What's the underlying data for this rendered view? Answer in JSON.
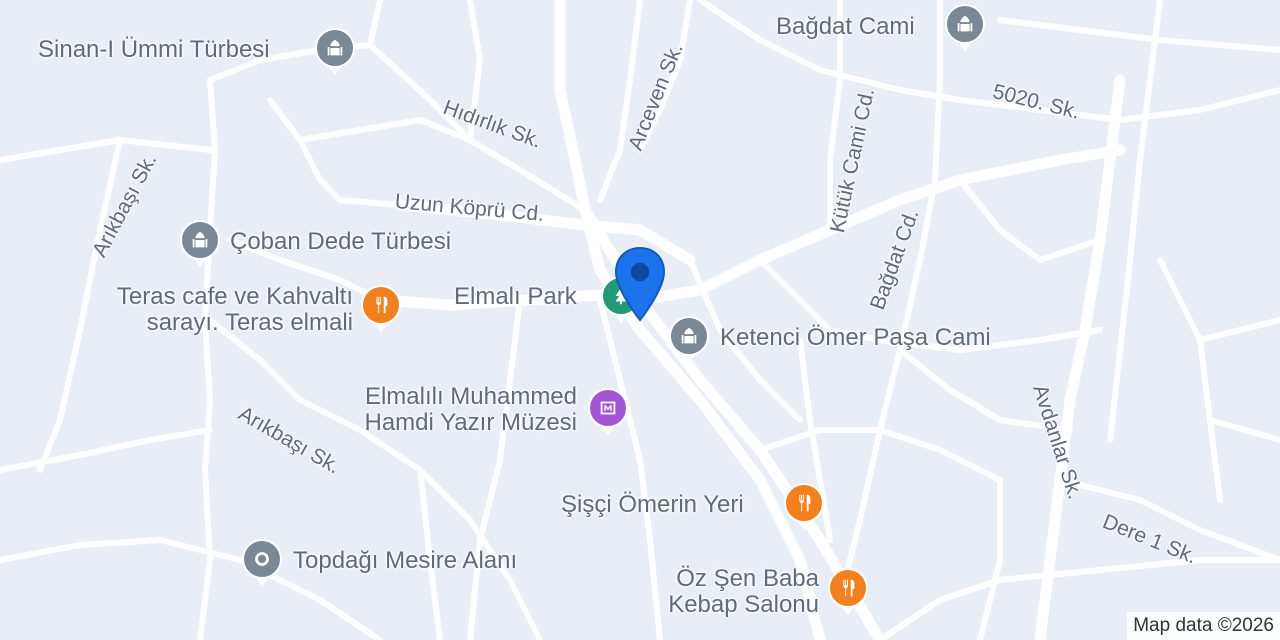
{
  "colors": {
    "land": "#e9edf6",
    "road": "#ffffff",
    "place_pin": "#7a8794",
    "food_pin": "#f2801e",
    "park_pin": "#1f9b76",
    "museum_pin": "#a256d6",
    "location_pin": "#1a73e8"
  },
  "places": {
    "sinan_turbesi": "Sinan-I Ümmi Türbesi",
    "bagdat_cami": "Bağdat Cami",
    "coban_dede": "Çoban Dede Türbesi",
    "teras_cafe_line1": "Teras cafe ve Kahvaltı",
    "teras_cafe_line2": "sarayı. Teras elmali",
    "elmali_park": "Elmalı Park",
    "ketenci": "Ketenci Ömer Paşa Cami",
    "muzesi_line1": "Elmalılı Muhammed",
    "muzesi_line2": "Hamdi Yazır Müzesi",
    "sisci": "Şişçi Ömerin Yeri",
    "topdagi": "Topdağı Mesire Alanı",
    "oz_sen_line1": "Öz Şen Baba",
    "oz_sen_line2": "Kebap Salonu"
  },
  "streets": {
    "hidirlik": "Hıdırlık Sk.",
    "arceven": "Arceven Sk.",
    "kutuk": "Kütük Cami Cd.",
    "s5020": "5020. Sk.",
    "arikbasi_top": "Arıkbaşı Sk.",
    "uzun_kopru": "Uzun Köprü Cd.",
    "bagdat_cd": "Bağdat Cd.",
    "arikbasi_bottom": "Arıkbaşı Sk.",
    "avdanlar": "Avdanlar Sk.",
    "dere": "Dere 1 Sk."
  },
  "attribution": "Map data ©2026"
}
